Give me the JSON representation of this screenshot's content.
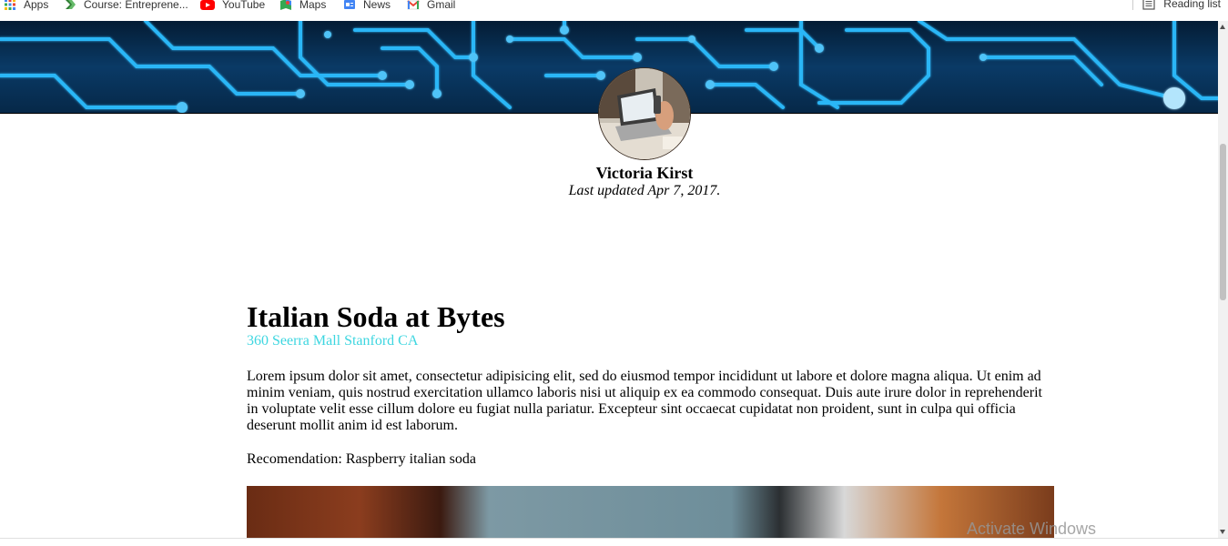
{
  "bookmarks": [
    {
      "label": "Apps",
      "icon": "apps-grid-icon",
      "color": "#1a73e8"
    },
    {
      "label": "Course: Entreprene...",
      "icon": "course-s-icon",
      "color": "#34a853"
    },
    {
      "label": "YouTube",
      "icon": "youtube-icon",
      "color": "#ff0000"
    },
    {
      "label": "Maps",
      "icon": "maps-icon",
      "color": "#34a853"
    },
    {
      "label": "News",
      "icon": "news-icon",
      "color": "#4285f4"
    },
    {
      "label": "Gmail",
      "icon": "gmail-icon",
      "color": "#ea4335"
    }
  ],
  "reading_list": {
    "label": "Reading list",
    "icon": "reading-list-icon"
  },
  "profile": {
    "author": "Victoria Kirst",
    "updated": "Last updated Apr 7, 2017."
  },
  "post": {
    "title": "Italian Soda at Bytes",
    "address": "360 Seerra Mall Stanford CA",
    "body": "Lorem ipsum dolor sit amet, consectetur adipisicing elit, sed do eiusmod tempor incididunt ut labore et dolore magna aliqua. Ut enim ad minim veniam, quis nostrud exercitation ullamco laboris nisi ut aliquip ex ea commodo consequat. Duis aute irure dolor in reprehenderit in voluptate velit esse cillum dolore eu fugiat nulla pariatur. Excepteur sint occaecat cupidatat non proident, sunt in culpa qui officia deserunt mollit anim id est laborum.",
    "recommendation": "Recomendation: Raspberry italian soda"
  },
  "watermark": "Activate Windows",
  "colors": {
    "accent": "#3dd6e0",
    "hero": "#0a3a66",
    "circuit": "#29b6f6"
  }
}
